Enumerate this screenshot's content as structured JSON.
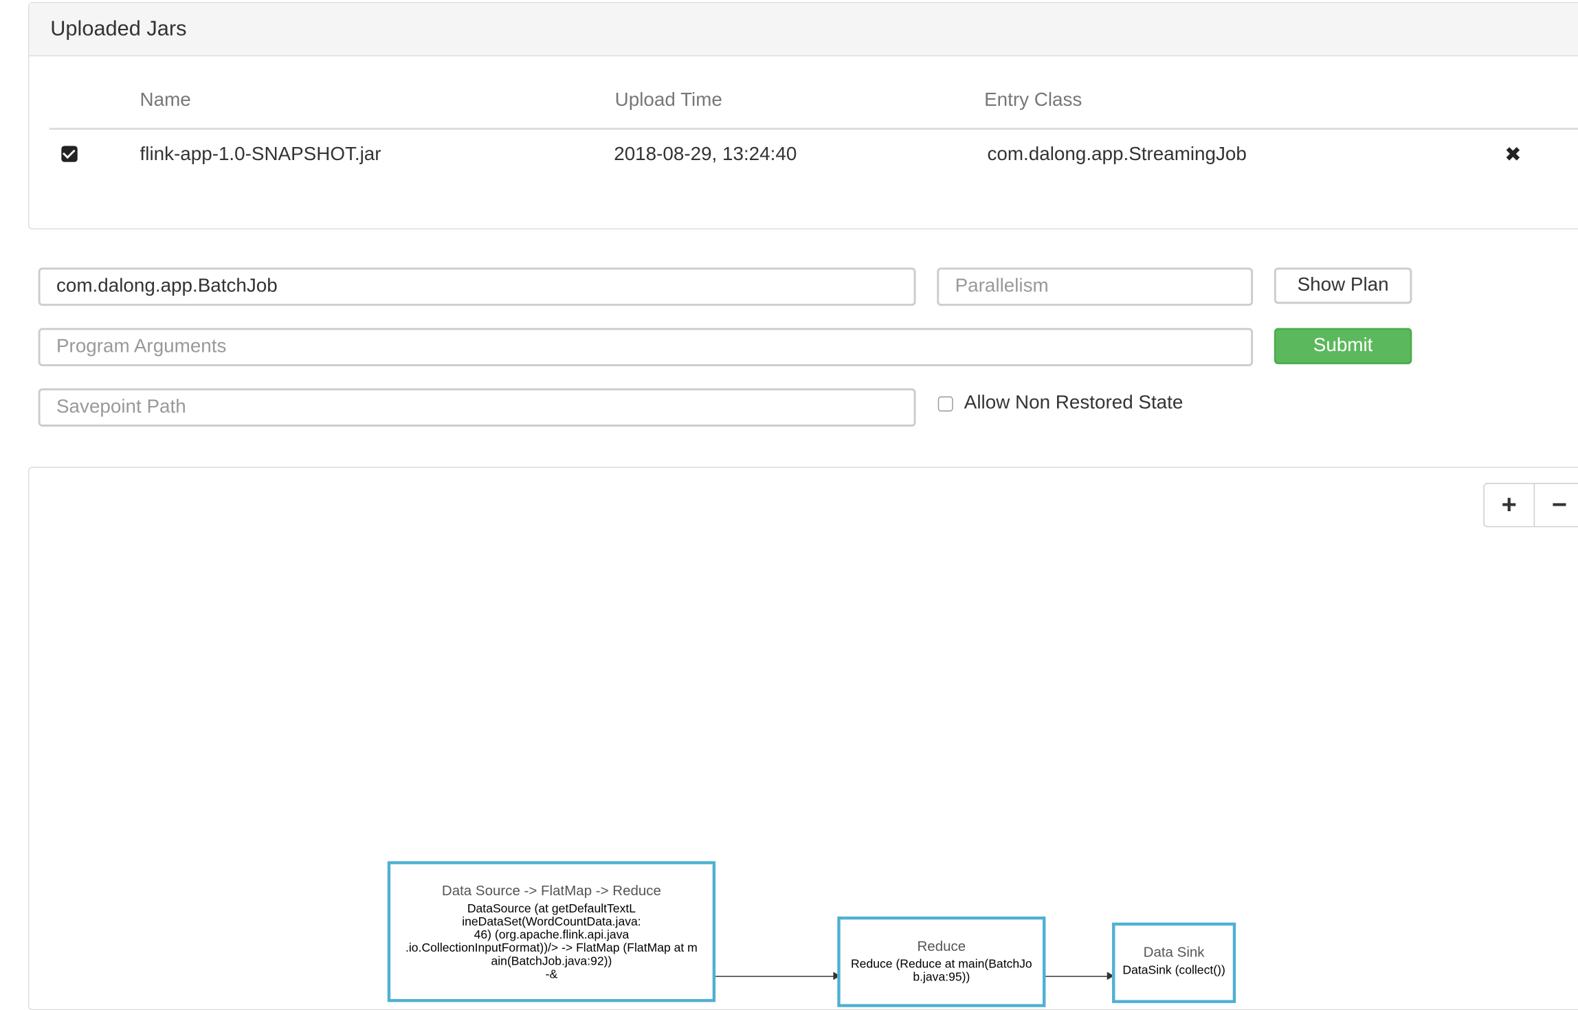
{
  "uploaded_jars": {
    "title": "Uploaded Jars",
    "columns": [
      "Name",
      "Upload Time",
      "Entry Class"
    ],
    "rows": [
      {
        "selected": true,
        "name": "flink-app-1.0-SNAPSHOT.jar",
        "upload_time": "2018-08-29, 13:24:40",
        "entry_class": "com.dalong.app.StreamingJob"
      }
    ],
    "delete_icon": "close-icon"
  },
  "form": {
    "entry_class_value": "com.dalong.app.BatchJob",
    "parallelism_placeholder": "Parallelism",
    "program_args_placeholder": "Program Arguments",
    "savepoint_placeholder": "Savepoint Path",
    "show_plan_label": "Show Plan",
    "submit_label": "Submit",
    "allow_non_restored_label": "Allow Non Restored State",
    "allow_non_restored_checked": false
  },
  "plan": {
    "zoom_in_label": "+",
    "zoom_out_label": "−",
    "nodes": [
      {
        "title": "Data Source -> FlatMap -> Reduce",
        "body": [
          "DataSource (at getDefaultTextL",
          "ineDataSet(WordCountData.java:",
          "46) (org.apache.flink.api.java",
          ".io.CollectionInputFormat))/> -> FlatMap (FlatMap at m",
          "ain(BatchJob.java:92))",
          "-&"
        ]
      },
      {
        "title": "Reduce",
        "body": [
          "Reduce (Reduce at main(BatchJo",
          "b.java:95))"
        ]
      },
      {
        "title": "Data Sink",
        "body": [
          "DataSink (collect())"
        ]
      }
    ]
  },
  "colors": {
    "submit_green": "#5cb85c",
    "node_border": "#4fb0d3",
    "panel_heading_bg": "#f5f5f5"
  }
}
